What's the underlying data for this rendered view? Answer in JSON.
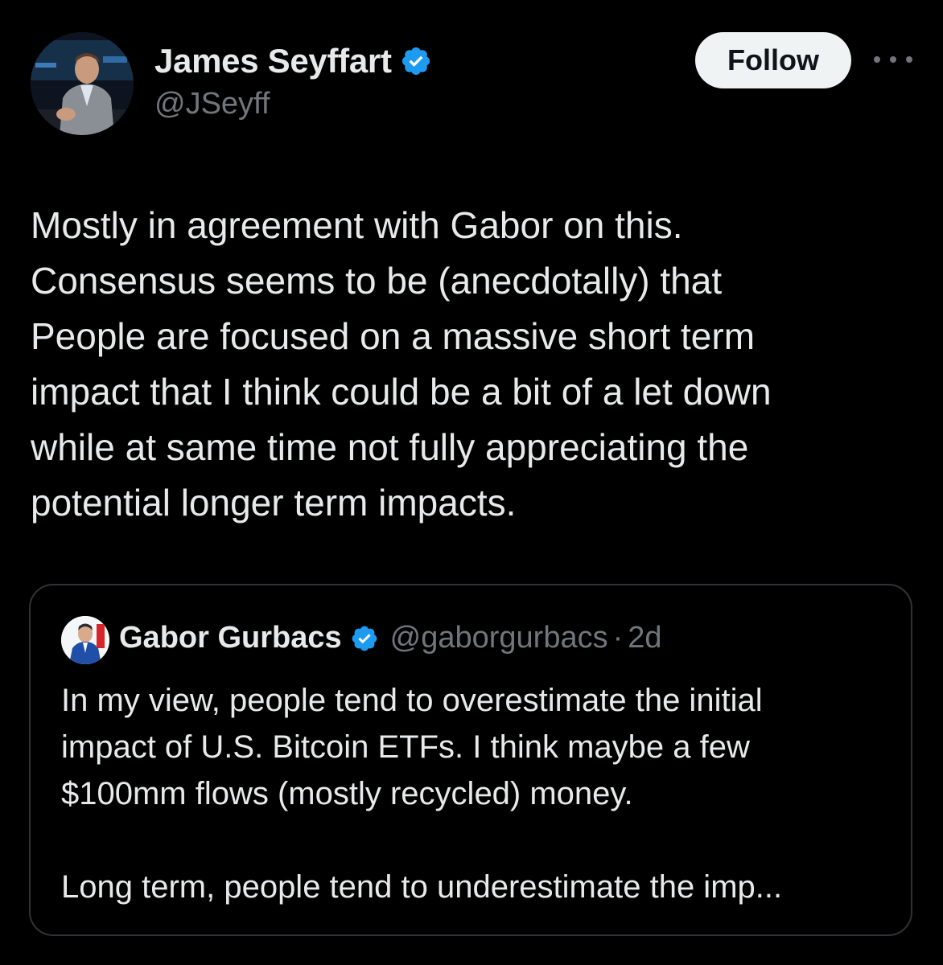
{
  "author": {
    "display_name": "James Seyffart",
    "handle": "@JSeyff",
    "verified_icon": "verified-badge-icon",
    "verified_color": "#1d9bf0"
  },
  "actions": {
    "follow_label": "Follow",
    "more_icon": "more-horizontal-icon"
  },
  "tweet": {
    "lines": [
      "Mostly in agreement with Gabor on this.",
      "Consensus seems to be (anecdotally) that",
      "People are focused on a massive short term",
      "impact that I think could be a bit of a let down",
      "while at same time not fully appreciating the",
      "potential longer term impacts."
    ]
  },
  "quote": {
    "display_name": "Gabor Gurbacs",
    "handle": "@gaborgurbacs",
    "separator": "·",
    "time": "2d",
    "lines": [
      "In my view, people tend to overestimate the initial",
      "impact of U.S. Bitcoin ETFs. I think maybe a few",
      "$100mm flows (mostly recycled) money.",
      "",
      "Long term, people tend to underestimate the imp..."
    ]
  },
  "colors": {
    "background": "#000000",
    "text_primary": "#e7e9ea",
    "text_secondary": "#71767b",
    "border": "#2f3336",
    "button_bg": "#eff3f4"
  }
}
